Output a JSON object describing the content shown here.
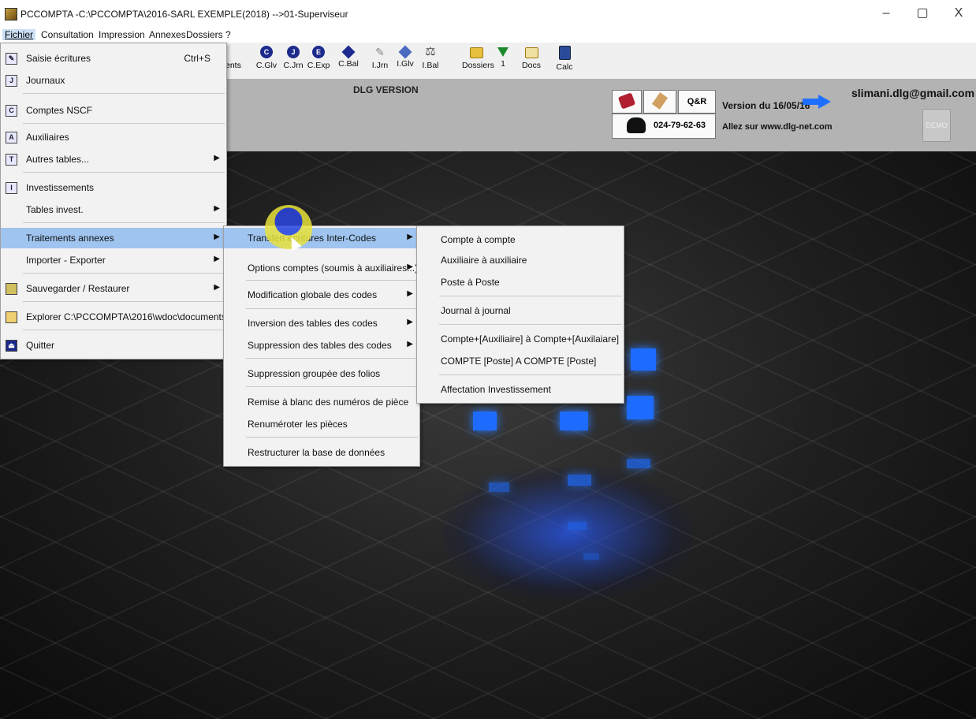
{
  "window": {
    "title": "PCCOMPTA -C:\\PCCOMPTA\\2016-SARL EXEMPLE(2018) -->01-Superviseur",
    "minimize": "–",
    "maximize": "▢",
    "close": "X"
  },
  "menubar": [
    "Fichier",
    "Consultation",
    "Impression",
    "Annexes",
    "Dossiers",
    "?"
  ],
  "toolbar": {
    "partial_label": "ents",
    "tools": [
      {
        "icon": "C",
        "label": "C.Glv"
      },
      {
        "icon": "J",
        "label": "C.Jrn"
      },
      {
        "icon": "E",
        "label": "C.Exp"
      },
      {
        "icon": "diamond",
        "label": "C.Bal"
      },
      {
        "icon": "pencil",
        "label": "I.Jrn"
      },
      {
        "icon": "diamond-blue",
        "label": "I.Glv"
      },
      {
        "icon": "scale",
        "label": "I.Bal"
      },
      {
        "icon": "folder",
        "label": "Dossiers"
      },
      {
        "icon": "filter",
        "label": "1"
      },
      {
        "icon": "folder",
        "label": "Docs"
      },
      {
        "icon": "calc",
        "label": "Calc"
      }
    ]
  },
  "info": {
    "dlg_version": "DLG VERSION",
    "qr_label": "Q&R",
    "phone": "024-79-62-63",
    "version_text": "Version du 16/05/16",
    "site_text": "Allez sur  www.dlg-net.com",
    "email": "slimani.dlg@gmail.com",
    "demo": "DEMO"
  },
  "menu_fichier": {
    "items": [
      {
        "icon": "pencil-icon",
        "label": "Saisie écritures",
        "shortcut": "Ctrl+S"
      },
      {
        "icon": "journal-icon",
        "label": "Journaux"
      },
      {
        "icon": "comptes-icon",
        "label": "Comptes NSCF"
      },
      {
        "icon": "auxiliaires-icon",
        "label": "Auxiliaires"
      },
      {
        "icon": "tables-icon",
        "label": "Autres tables..."
      },
      {
        "icon": "invest-icon",
        "label": "Investissements"
      },
      {
        "icon": "",
        "label": "Tables invest."
      },
      {
        "icon": "",
        "label": "Traitements annexes"
      },
      {
        "icon": "",
        "label": "Importer - Exporter"
      },
      {
        "icon": "save-icon",
        "label": "Sauvegarder / Restaurer"
      },
      {
        "icon": "folder-icon",
        "label": "Explorer C:\\PCCOMPTA\\2016\\wdoc\\documents"
      },
      {
        "icon": "exit-icon",
        "label": "Quitter"
      }
    ]
  },
  "menu_traitements": {
    "items": [
      "Transfert écritures Inter-Codes",
      "Options comptes  (soumis à auxiliaires...)",
      "Modification globale des codes",
      "Inversion des tables des codes",
      "Suppression des tables des codes",
      "Suppression groupée des folios",
      "Remise à blanc des numéros de pièce",
      "Renuméroter les pièces",
      "Restructurer la base de données"
    ]
  },
  "menu_transfert": {
    "items": [
      "Compte à  compte",
      "Auxiliaire à auxiliaire",
      "Poste à Poste",
      "Journal à journal",
      "Compte+[Auxiliaire] à Compte+[Auxilaiare]",
      "COMPTE [Poste] A COMPTE [Poste]",
      "Affectation Investissement"
    ]
  },
  "arrow": "▶"
}
